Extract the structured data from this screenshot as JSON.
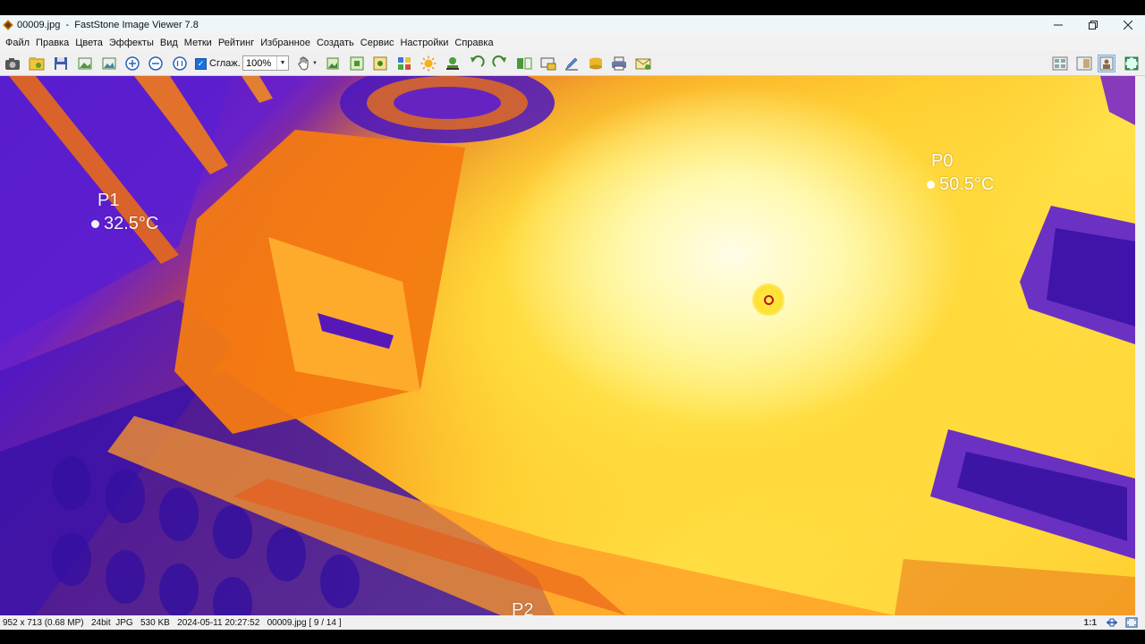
{
  "window": {
    "filename": "00009.jpg",
    "separator": "-",
    "app_name": "FastStone Image Viewer 7.8"
  },
  "menu": [
    "Файл",
    "Правка",
    "Цвета",
    "Эффекты",
    "Вид",
    "Метки",
    "Рейтинг",
    "Избранное",
    "Создать",
    "Сервис",
    "Настройки",
    "Справка"
  ],
  "toolbar": {
    "smooth_label": "Сглаж.",
    "smooth_checked": true,
    "zoom_value": "100%"
  },
  "image": {
    "points": [
      {
        "name": "P0",
        "temp": "50.5°C"
      },
      {
        "name": "P1",
        "temp": "32.5°C"
      },
      {
        "name": "P2"
      }
    ]
  },
  "status": {
    "dimensions": "952 x 713 (0.68 MP)",
    "bitdepth": "24bit",
    "format": "JPG",
    "size": "530 KB",
    "datetime": "2024-05-11 20:27:52",
    "file_index": "00009.jpg [ 9 / 14 ]",
    "ratio": "1:1"
  },
  "colors": {
    "accent": "#1e6fd9",
    "hot": "#fff9b0",
    "warm": "#f47a12",
    "cold": "#4818c8"
  }
}
